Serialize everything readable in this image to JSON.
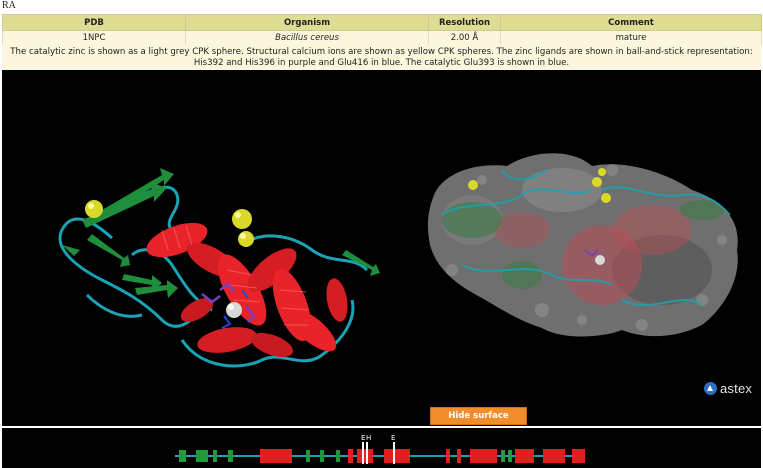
{
  "header": {
    "label": "RA"
  },
  "table": {
    "columns": [
      "PDB",
      "Organism",
      "Resolution",
      "Comment"
    ],
    "row": {
      "pdb": "1NPC",
      "organism": "Bacillus cereus",
      "resolution": "2.00 Å",
      "comment": "mature"
    }
  },
  "caption": "The catalytic zinc is shown as a light grey CPK sphere. Structural calcium ions are shown as yellow CPK spheres. The zinc ligands are shown in ball-and-stick representation: His392 and His396 in purple and Glu416 in blue. The catalytic Glu393 is shown in blue.",
  "viewer": {
    "logo_text": "astex",
    "button_label": "Hide surface",
    "colors": {
      "helix": "#e8232a",
      "strand": "#1f8e3c",
      "loop": "#1aa3b5",
      "calcium": "#d9d92a",
      "zinc": "#d8d8d8",
      "ligand_purple": "#7b3fb8",
      "surface": "#6f6f6f",
      "button": "#f28d2c"
    }
  },
  "sequence": {
    "markers": [
      "E",
      "H",
      "E"
    ],
    "colors": {
      "helix": "#e02020",
      "strand": "#1f9a3c",
      "line": "#1aa3b5"
    }
  }
}
